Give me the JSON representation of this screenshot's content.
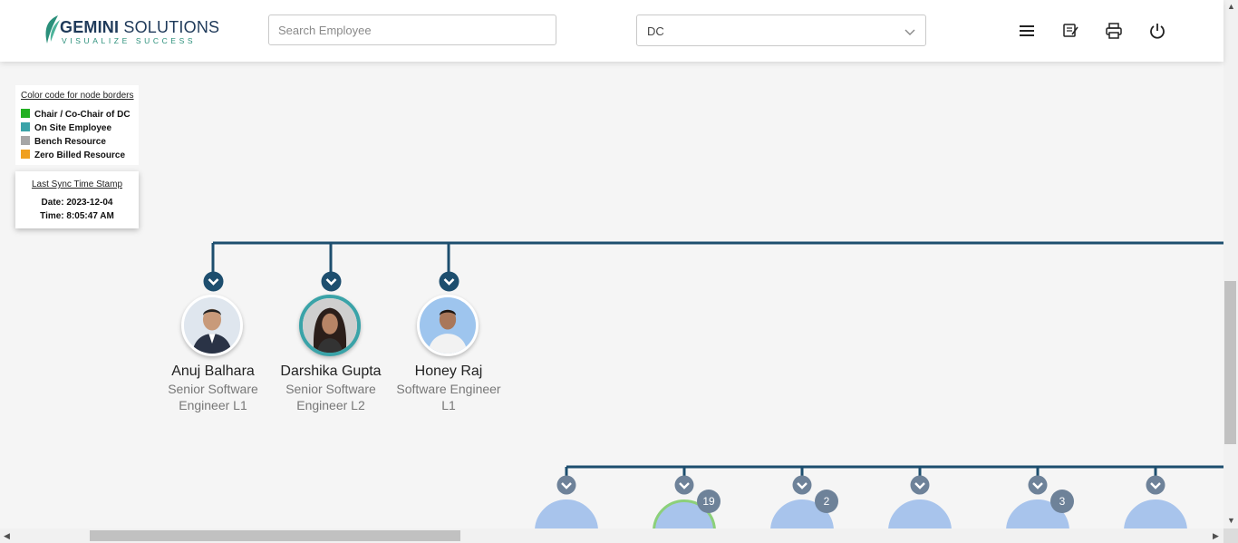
{
  "header": {
    "logo_brand_bold": "GEMINI",
    "logo_brand_rest": " SOLUTIONS",
    "logo_tagline": "VISUALIZE SUCCESS",
    "search_placeholder": "Search Employee",
    "search_value": "",
    "dept_select_value": "DC",
    "icons": [
      "menu-icon",
      "notes-icon",
      "print-icon",
      "power-icon"
    ]
  },
  "legend": {
    "title": "Color code for node borders",
    "items": [
      {
        "label": "Chair / Co-Chair of DC",
        "color": "#22b022"
      },
      {
        "label": "On Site Employee",
        "color": "#3aa3a8"
      },
      {
        "label": "Bench Resource",
        "color": "#a6a6a6"
      },
      {
        "label": "Zero Billed Resource",
        "color": "#f0a020"
      }
    ]
  },
  "sync": {
    "title": "Last Sync Time Stamp",
    "date": "Date: 2023-12-04",
    "time": "Time: 8:05:47 AM"
  },
  "employees": [
    {
      "name": "Anuj Balhara",
      "role": "Senior Software Engineer L1",
      "border_color": "#ffffff"
    },
    {
      "name": "Darshika Gupta",
      "role": "Senior Software Engineer L2",
      "border_color": "#3aa3a8"
    },
    {
      "name": "Honey Raj",
      "role": "Software Engineer L1",
      "border_color": "#ffffff"
    }
  ],
  "sub_nodes": [
    {
      "count": "",
      "border_color": "#a8c4ec"
    },
    {
      "count": "19",
      "border_color": "#8cd07a"
    },
    {
      "count": "2",
      "border_color": "#a8c4ec"
    },
    {
      "count": "",
      "border_color": "#a8c4ec"
    },
    {
      "count": "3",
      "border_color": "#a8c4ec"
    },
    {
      "count": "",
      "border_color": "#a8c4ec"
    }
  ],
  "colors": {
    "connector": "#1d4e6e",
    "sub_connector": "#6e8299",
    "accent": "#1f3a5a"
  }
}
